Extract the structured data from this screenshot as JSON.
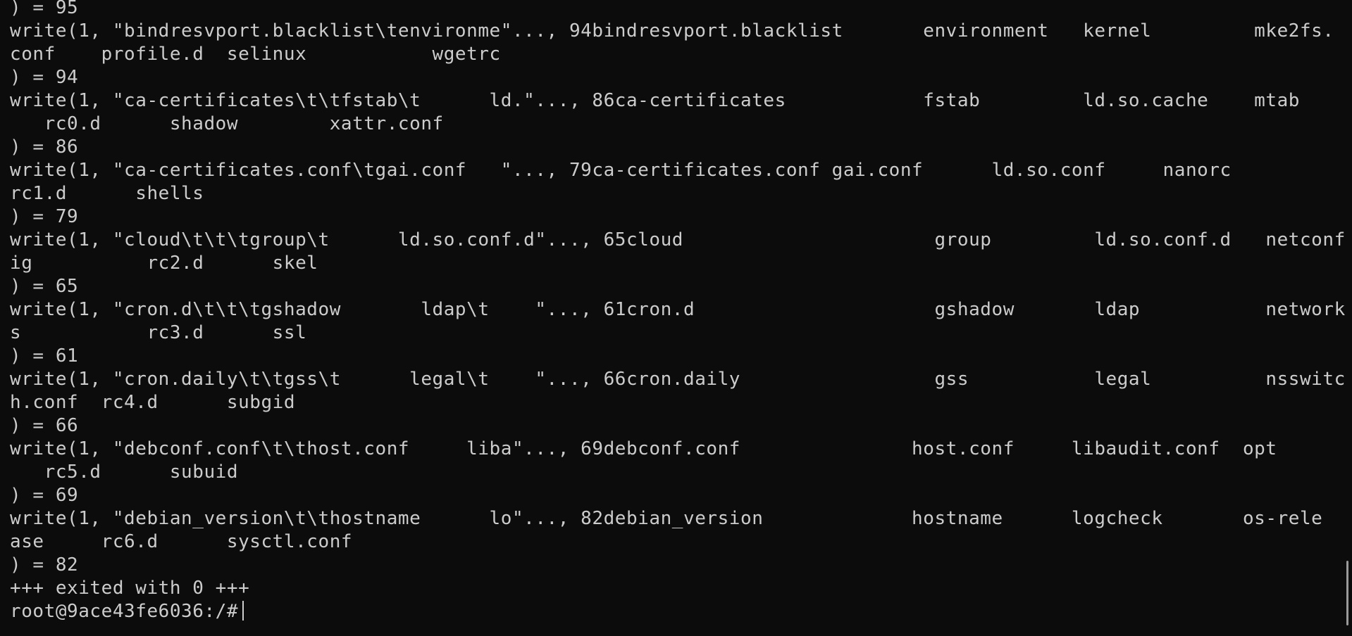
{
  "terminal": {
    "lines": [
      ") = 95",
      "write(1, \"bindresvport.blacklist\\tenvironme\"..., 94bindresvport.blacklist       environment   kernel         mke2fs.",
      "conf    profile.d  selinux           wgetrc",
      ") = 94",
      "write(1, \"ca-certificates\\t\\tfstab\\t      ld.\"..., 86ca-certificates            fstab         ld.so.cache    mtab",
      "   rc0.d      shadow        xattr.conf",
      ") = 86",
      "write(1, \"ca-certificates.conf\\tgai.conf   \"..., 79ca-certificates.conf gai.conf      ld.so.conf     nanorc",
      "rc1.d      shells",
      ") = 79",
      "write(1, \"cloud\\t\\t\\tgroup\\t      ld.so.conf.d\"..., 65cloud                      group         ld.so.conf.d   netconf",
      "ig          rc2.d      skel",
      ") = 65",
      "write(1, \"cron.d\\t\\t\\tgshadow       ldap\\t    \"..., 61cron.d                     gshadow       ldap           network",
      "s           rc3.d      ssl",
      ") = 61",
      "write(1, \"cron.daily\\t\\tgss\\t      legal\\t    \"..., 66cron.daily                 gss           legal          nsswitc",
      "h.conf  rc4.d      subgid",
      ") = 66",
      "write(1, \"debconf.conf\\t\\thost.conf     liba\"..., 69debconf.conf               host.conf     libaudit.conf  opt",
      "   rc5.d      subuid",
      ") = 69",
      "write(1, \"debian_version\\t\\thostname      lo\"..., 82debian_version             hostname      logcheck       os-rele",
      "ase     rc6.d      sysctl.conf",
      ") = 82",
      "+++ exited with 0 +++"
    ],
    "prompt": "root@9ace43fe6036:/#"
  }
}
